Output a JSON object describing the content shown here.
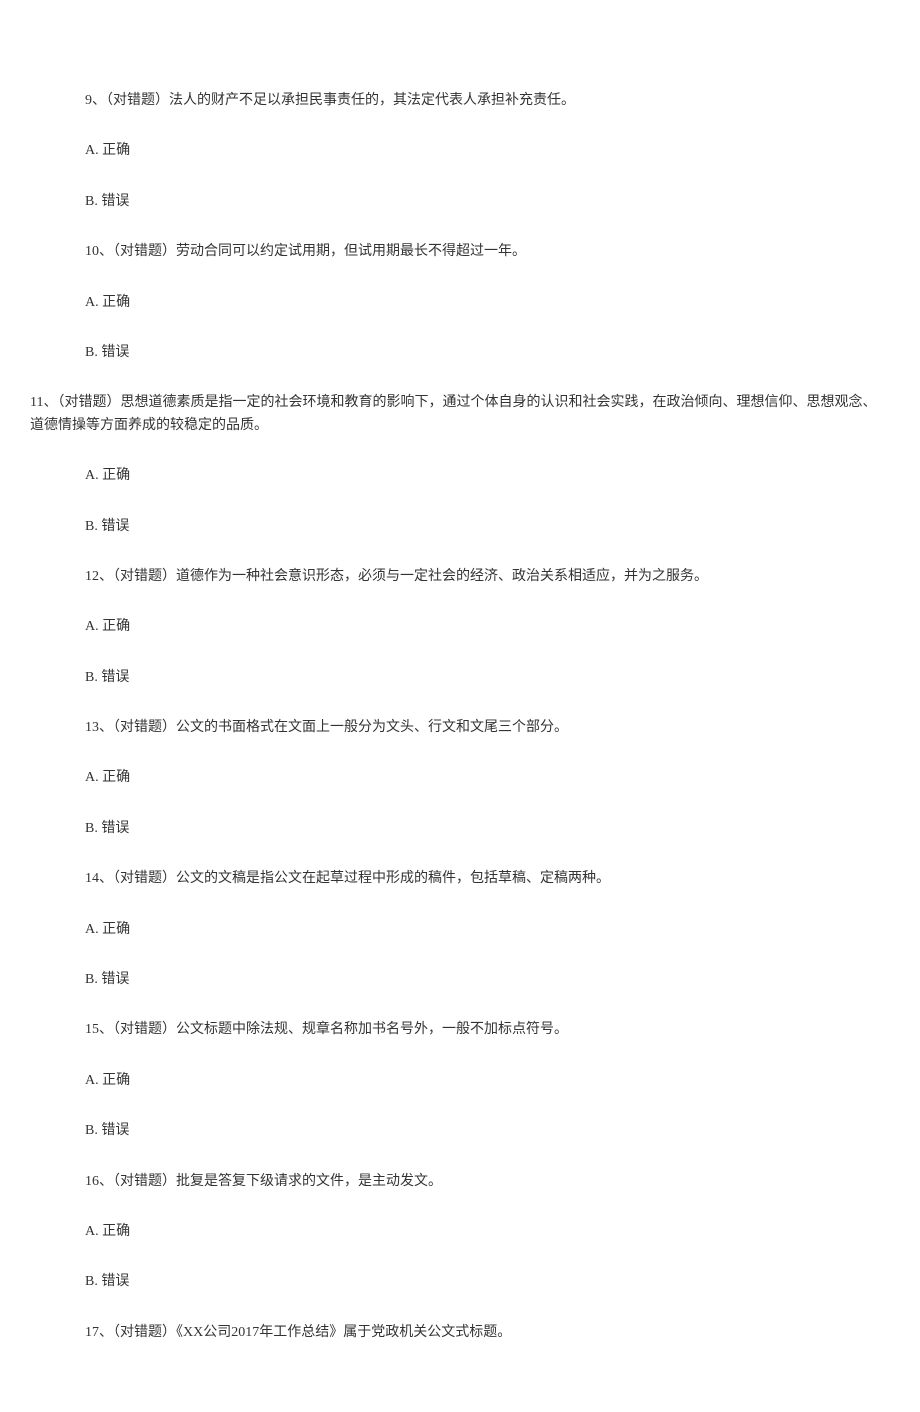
{
  "questions": [
    {
      "number": "9、",
      "type": "（对错题）",
      "text": "法人的财产不足以承担民事责任的，其法定代表人承担补充责任。",
      "optionA": "A. 正确",
      "optionB": "B. 错误",
      "indent": true
    },
    {
      "number": "10、",
      "type": "（对错题）",
      "text": "劳动合同可以约定试用期，但试用期最长不得超过一年。",
      "optionA": "A. 正确",
      "optionB": "B. 错误",
      "indent": true
    },
    {
      "number": "11、",
      "type": "（对错题）",
      "text": "思想道德素质是指一定的社会环境和教育的影响下，通过个体自身的认识和社会实践，在政治倾向、理想信仰、思想观念、道德情操等方面养成的较稳定的品质。",
      "optionA": "A. 正确",
      "optionB": "B. 错误",
      "indent": false
    },
    {
      "number": "12、",
      "type": "（对错题）",
      "text": "道德作为一种社会意识形态，必须与一定社会的经济、政治关系相适应，并为之服务。",
      "optionA": "A. 正确",
      "optionB": "B. 错误",
      "indent": true
    },
    {
      "number": "13、",
      "type": "（对错题）",
      "text": "公文的书面格式在文面上一般分为文头、行文和文尾三个部分。",
      "optionA": "A. 正确",
      "optionB": "B. 错误",
      "indent": true
    },
    {
      "number": "14、",
      "type": "（对错题）",
      "text": "公文的文稿是指公文在起草过程中形成的稿件，包括草稿、定稿两种。",
      "optionA": "A. 正确",
      "optionB": "B. 错误",
      "indent": true
    },
    {
      "number": "15、",
      "type": "（对错题）",
      "text": "公文标题中除法规、规章名称加书名号外，一般不加标点符号。",
      "optionA": "A. 正确",
      "optionB": "B. 错误",
      "indent": true
    },
    {
      "number": "16、",
      "type": "（对错题）",
      "text": "批复是答复下级请求的文件，是主动发文。",
      "optionA": "A. 正确",
      "optionB": "B. 错误",
      "indent": true
    },
    {
      "number": "17、",
      "type": "（对错题）",
      "text": "《XX公司2017年工作总结》属于党政机关公文式标题。",
      "optionA": "",
      "optionB": "",
      "indent": true
    }
  ]
}
